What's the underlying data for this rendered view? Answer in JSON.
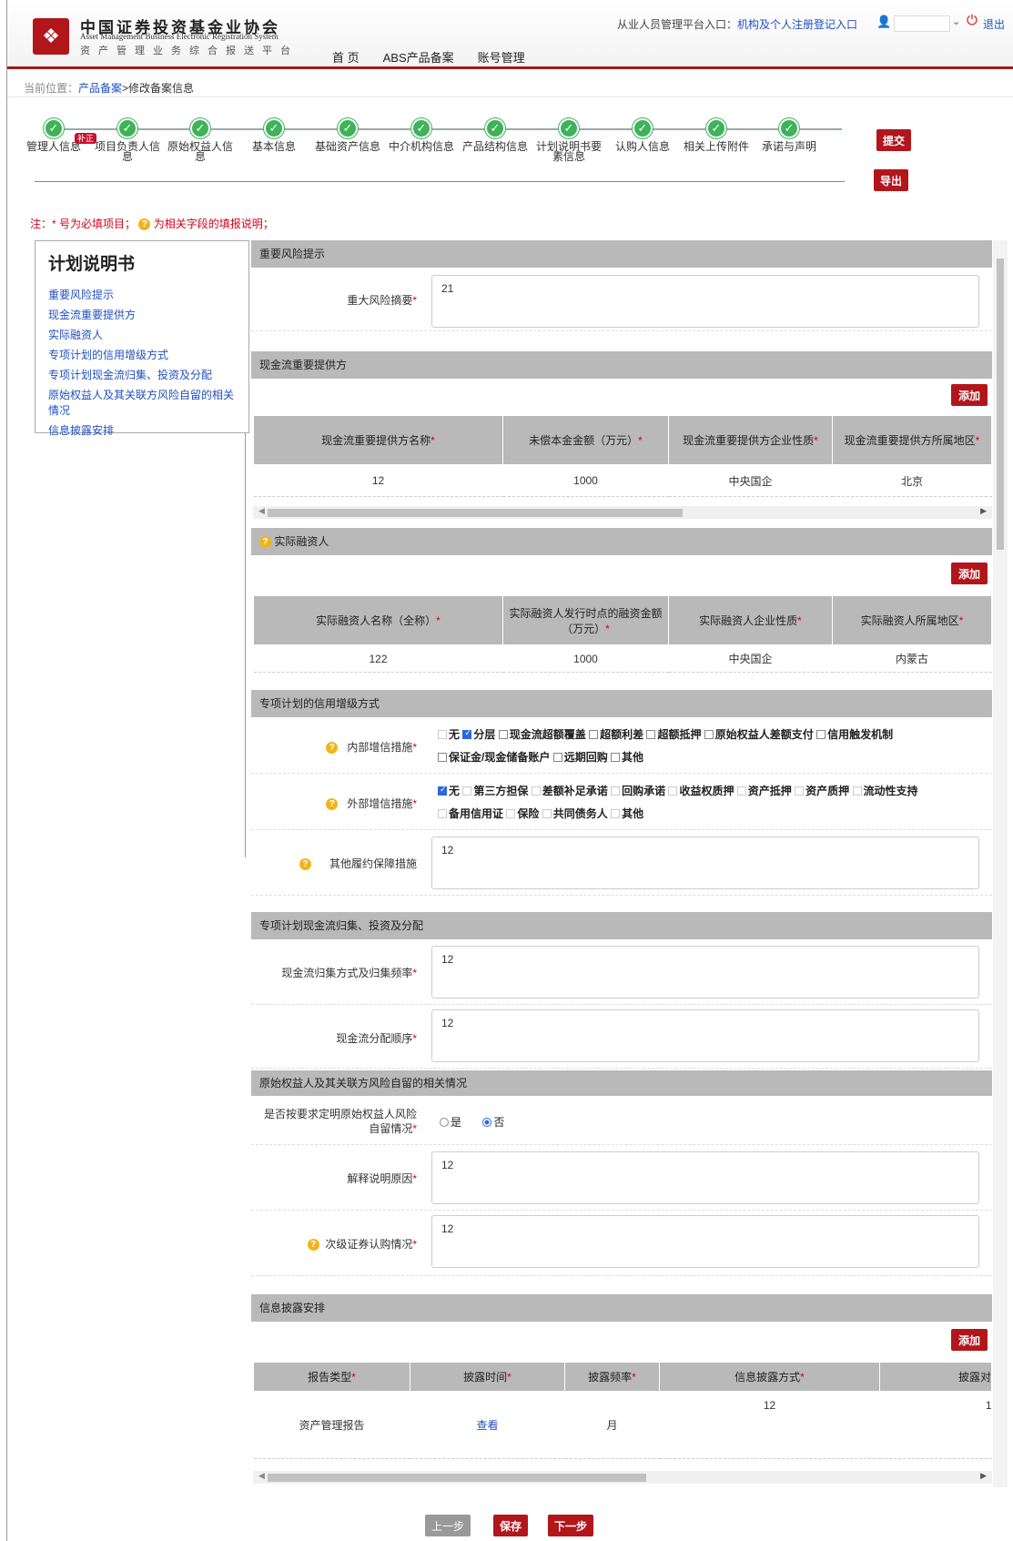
{
  "header": {
    "org_cn": "中国证券投资基金业协会",
    "org_en": "Asset Management Business Electronic Registration System",
    "org_sub": "资产管理业务综合报送平台",
    "nav": [
      "首 页",
      "ABS产品备案",
      "账号管理"
    ],
    "entry_text": "从业人员管理平台入口：",
    "entry_link": "机构及个人注册登记入口",
    "logout": "退出"
  },
  "breadcrumb": {
    "prefix": "当前位置：",
    "link": "产品备案",
    "current": ">修改备案信息"
  },
  "steps": [
    {
      "label": "管理人信息"
    },
    {
      "label": "项目负责人信息"
    },
    {
      "label": "原始权益人信息"
    },
    {
      "label": "基本信息"
    },
    {
      "label": "基础资产信息"
    },
    {
      "label": "中介机构信息"
    },
    {
      "label": "产品结构信息"
    },
    {
      "label": "计划说明书要素信息"
    },
    {
      "label": "认购人信息"
    },
    {
      "label": "相关上传附件"
    },
    {
      "label": "承诺与声明"
    }
  ],
  "badge_fix": "补正",
  "buttons": {
    "submit": "提交",
    "export": "导出",
    "add": "添加",
    "prev": "上一步",
    "save": "保存",
    "next": "下一步"
  },
  "note": {
    "prefix": "注：* 号为必填项目；",
    "suffix": "为相关字段的填报说明；"
  },
  "toc": {
    "title": "计划说明书",
    "items": [
      "重要风险提示",
      "现金流重要提供方",
      "实际融资人",
      "专项计划的信用增级方式",
      "专项计划现金流归集、投资及分配",
      "原始权益人及其关联方风险自留的相关情况",
      "信息披露安排"
    ]
  },
  "risk": {
    "section": "重要风险提示",
    "label": "重大风险摘要",
    "value": "21"
  },
  "cashflow": {
    "section": "现金流重要提供方",
    "headers": [
      "现金流重要提供方名称",
      "未偿本金金额（万元）",
      "现金流重要提供方企业性质",
      "现金流重要提供方所属地区"
    ],
    "row": [
      "12",
      "1000",
      "中央国企",
      "北京"
    ]
  },
  "financier": {
    "section": "实际融资人",
    "headers": [
      "实际融资人名称（全称）",
      "实际融资人发行时点的融资金额（万元）",
      "实际融资人企业性质",
      "实际融资人所属地区"
    ],
    "row": [
      "122",
      "1000",
      "中央国企",
      "内蒙古"
    ]
  },
  "credit": {
    "section": "专项计划的信用增级方式",
    "internal_label": "内部增信措施",
    "internal_line1": [
      "无",
      "分层",
      "现金流超额覆盖",
      "超额利差",
      "超额抵押",
      "原始权益人差额支付",
      "信用触发机制"
    ],
    "internal_line2": [
      "保证金/现金储备账户",
      "远期回购",
      "其他"
    ],
    "external_label": "外部增信措施",
    "external_line1": [
      "无",
      "第三方担保",
      "差额补足承诺",
      "回购承诺",
      "收益权质押",
      "资产抵押",
      "资产质押",
      "流动性支持"
    ],
    "external_line2": [
      "备用信用证",
      "保险",
      "共同债务人",
      "其他"
    ],
    "other_label": "其他履约保障措施",
    "other_value": "12"
  },
  "flow": {
    "section": "专项计划现金流归集、投资及分配",
    "collect_label": "现金流归集方式及归集频率",
    "collect_value": "12",
    "order_label": "现金流分配顺序",
    "order_value": "12"
  },
  "retention": {
    "section": "原始权益人及其关联方风险自留的相关情况",
    "q_label1": "是否按要求定明原始权益人风险",
    "q_label2": "自留情况",
    "yes": "是",
    "no": "否",
    "reason_label": "解释说明原因",
    "reason_value": "12",
    "sub_label": "次级证券认购情况",
    "sub_value": "12"
  },
  "disclosure": {
    "section": "信息披露安排",
    "headers": [
      "报告类型",
      "披露时间",
      "披露频率",
      "信息披露方式",
      "披露对"
    ],
    "row": [
      "资产管理报告",
      "查看",
      "月",
      "12",
      "1"
    ]
  },
  "colors": {
    "brand_red": "#b2161b",
    "step_green": "#3fb25a",
    "link_blue": "#2050c0",
    "section_gray": "#b9b9b9"
  }
}
